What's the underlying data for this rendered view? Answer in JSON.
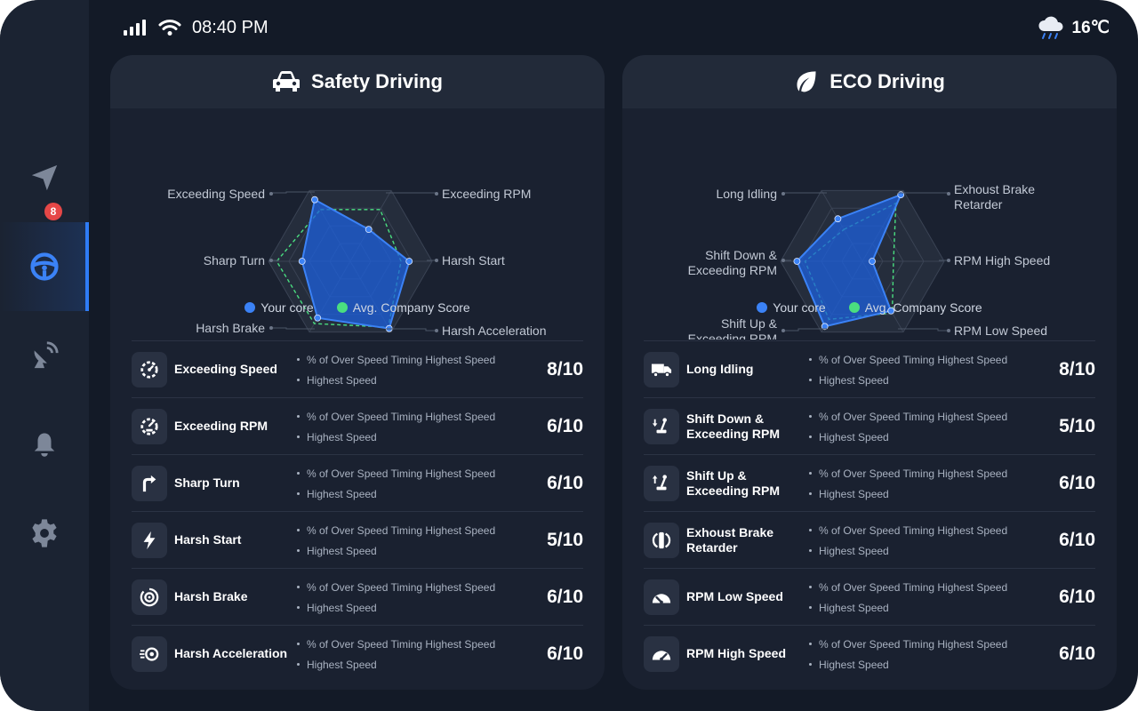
{
  "status": {
    "time": "08:40 PM",
    "temperature": "16℃",
    "weather_icon": "cloud-rain-icon"
  },
  "sidebar": {
    "items": [
      {
        "name": "navigation",
        "icon": "navigation-arrow-icon"
      },
      {
        "name": "driving",
        "icon": "steering-wheel-icon",
        "active": true
      },
      {
        "name": "satellite",
        "icon": "satellite-dish-icon"
      },
      {
        "name": "notifications",
        "icon": "bell-icon",
        "badge": "8"
      },
      {
        "name": "settings",
        "icon": "gear-icon"
      }
    ]
  },
  "colors": {
    "accent": "#2f7cf6",
    "your_score": "#3b82f6",
    "company_score": "#4ade80"
  },
  "safety": {
    "title": "Safety Driving",
    "legend": {
      "yours": "Your core",
      "company": "Avg. Company Score"
    },
    "axis_labels": [
      "Exceeding Speed",
      "Exceeding RPM",
      "Sharp Turn",
      "Harsh Start",
      "Harsh Brake",
      "Harsh Acceleration"
    ],
    "rows": [
      {
        "title": "Exceeding Speed",
        "desc1": "% of Over Speed Timing Highest Speed",
        "desc2": "Highest Speed",
        "score": "8/10"
      },
      {
        "title": "Exceeding RPM",
        "desc1": "% of Over Speed Timing Highest Speed",
        "desc2": "Highest Speed",
        "score": "6/10"
      },
      {
        "title": "Sharp Turn",
        "desc1": "% of Over Speed Timing Highest Speed",
        "desc2": "Highest Speed",
        "score": "6/10"
      },
      {
        "title": "Harsh Start",
        "desc1": "% of Over Speed Timing Highest Speed",
        "desc2": "Highest Speed",
        "score": "5/10"
      },
      {
        "title": "Harsh Brake",
        "desc1": "% of Over Speed Timing Highest Speed",
        "desc2": "Highest Speed",
        "score": "6/10"
      },
      {
        "title": "Harsh Acceleration",
        "desc1": "% of Over Speed Timing Highest Speed",
        "desc2": "Highest Speed",
        "score": "6/10"
      }
    ]
  },
  "eco": {
    "title": "ECO Driving",
    "legend": {
      "yours": "Your core",
      "company": "Avg. Company Score"
    },
    "axis_labels": [
      "Long Idling",
      "Exhoust Brake Retarder",
      "Shift Down & Exceeding RPM",
      "RPM High Speed",
      "Shift Up & Exceeding RPM",
      "RPM Low Speed"
    ],
    "rows": [
      {
        "title": "Long Idling",
        "desc1": "% of Over Speed Timing Highest Speed",
        "desc2": "Highest Speed",
        "score": "8/10"
      },
      {
        "title": "Shift Down & Exceeding RPM",
        "desc1": "% of Over Speed Timing Highest Speed",
        "desc2": "Highest Speed",
        "score": "5/10"
      },
      {
        "title": "Shift Up & Exceeding RPM",
        "desc1": "% of Over Speed Timing Highest Speed",
        "desc2": "Highest Speed",
        "score": "6/10"
      },
      {
        "title": "Exhoust Brake Retarder",
        "desc1": "% of Over Speed Timing Highest Speed",
        "desc2": "Highest Speed",
        "score": "6/10"
      },
      {
        "title": "RPM Low Speed",
        "desc1": "% of Over Speed Timing Highest Speed",
        "desc2": "Highest Speed",
        "score": "6/10"
      },
      {
        "title": "RPM High Speed",
        "desc1": "% of Over Speed Timing Highest Speed",
        "desc2": "Highest Speed",
        "score": "6/10"
      }
    ]
  },
  "chart_data": [
    {
      "type": "radar",
      "axes": [
        "Exceeding Speed",
        "Exceeding RPM",
        "Harsh Start",
        "Harsh Acceleration",
        "Harsh Brake",
        "Sharp Turn"
      ],
      "series": [
        {
          "name": "Your core",
          "values": [
            0.87,
            0.45,
            0.72,
            0.95,
            0.8,
            0.59
          ]
        },
        {
          "name": "Avg. Company Score",
          "values": [
            0.73,
            0.73,
            0.62,
            0.93,
            0.88,
            0.9
          ]
        }
      ],
      "range": [
        0,
        1
      ]
    },
    {
      "type": "radar",
      "axes": [
        "Long Idling",
        "Exhoust Brake Retarder",
        "RPM High Speed",
        "RPM Low Speed",
        "Shift Up & Exceeding RPM",
        "Shift Down & Exceeding RPM"
      ],
      "series": [
        {
          "name": "Your core",
          "values": [
            0.6,
            0.94,
            0.12,
            0.7,
            0.92,
            0.8
          ]
        },
        {
          "name": "Avg. Company Score",
          "values": [
            0.45,
            0.82,
            0.38,
            0.73,
            0.82,
            0.7
          ]
        }
      ],
      "range": [
        0,
        1
      ]
    }
  ]
}
